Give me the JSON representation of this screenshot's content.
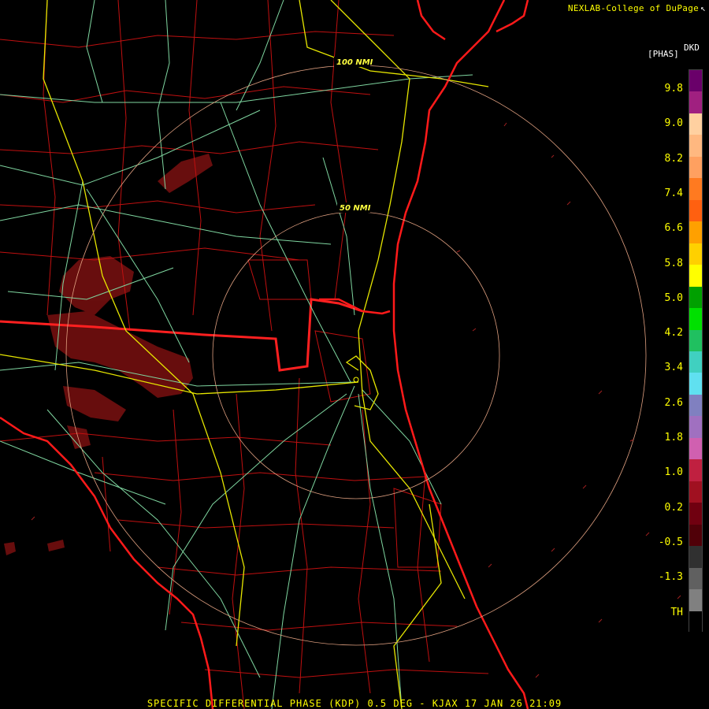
{
  "header": {
    "credit": "NEXLAB-College of DuPage",
    "credit_mark": "↖"
  },
  "map": {
    "radar_site": "KJAX",
    "range_rings": [
      {
        "label": "50 NMI"
      },
      {
        "label": "100 NMI"
      }
    ],
    "colors": {
      "background": "#000000",
      "coastline": "#ff1a1a",
      "state_border": "#ff2020",
      "county_border": "#c01010",
      "interstate": "#e6e600",
      "highway": "#7fd6a0",
      "range_ring": "#e0a080",
      "echo": "#7a1010"
    }
  },
  "legend": {
    "product": "DKD",
    "unit": "[PHAS]",
    "labels": [
      "9.8",
      "9.0",
      "8.2",
      "7.4",
      "6.6",
      "5.8",
      "5.0",
      "4.2",
      "3.4",
      "2.6",
      "1.8",
      "1.0",
      "0.2",
      "-0.5",
      "-1.3",
      "TH"
    ],
    "colors": [
      "#6a006a",
      "#a02080",
      "#ffd0a0",
      "#ffb880",
      "#ffa060",
      "#ff7a20",
      "#ff6010",
      "#ffa000",
      "#ffd000",
      "#ffff00",
      "#00a000",
      "#00e000",
      "#20c060",
      "#40d0c0",
      "#60e0f0",
      "#8080c0",
      "#a070c0",
      "#d060b0",
      "#c02040",
      "#a01020",
      "#700010",
      "#500008",
      "#303030",
      "#606060",
      "#808080",
      "#000000"
    ]
  },
  "footer": {
    "caption": "SPECIFIC DIFFERENTIAL PHASE (KDP) 0.5 DEG - KJAX 17 JAN 26 21:09"
  }
}
